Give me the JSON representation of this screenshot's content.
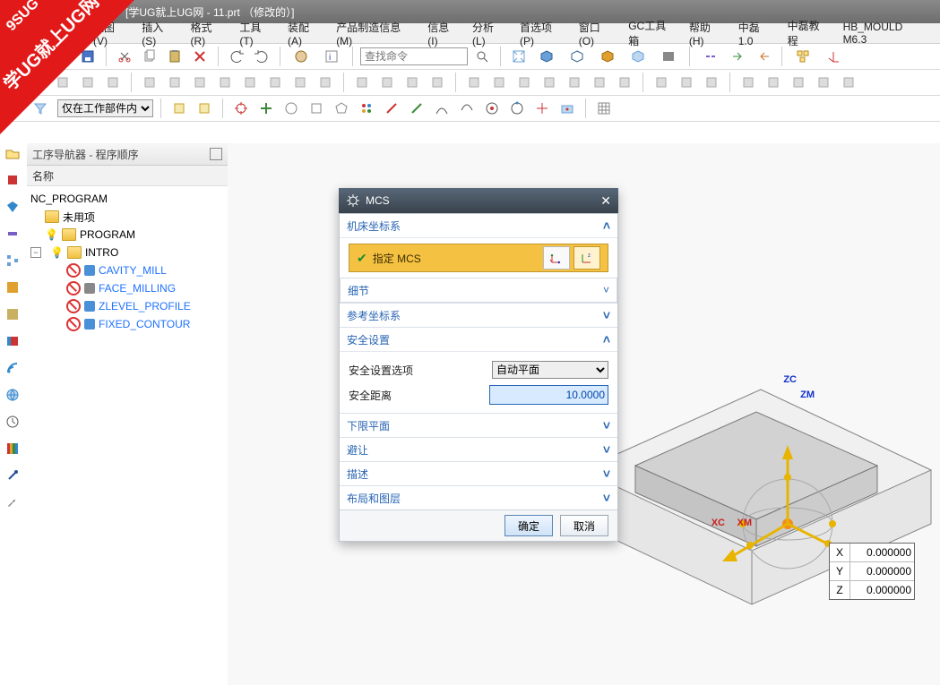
{
  "watermark": {
    "big": "学UG就上UG网",
    "small": "9SUG"
  },
  "title": "[学UG就上UG网 - 11.prt （修改的）]",
  "menus": [
    "视图(V)",
    "插入(S)",
    "格式(R)",
    "工具(T)",
    "装配(A)",
    "产品制造信息(M)",
    "信息(I)",
    "分析(L)",
    "首选项(P)",
    "窗口(O)",
    "GC工具箱",
    "帮助(H)",
    "中磊1.0",
    "中磊教程",
    "HB_MOULD M6.3"
  ],
  "search_placeholder": "查找命令",
  "scope_options": [
    "仅在工作部件内"
  ],
  "scope_value": "仅在工作部件内",
  "nav": {
    "panel_title": "工序导航器 - 程序顺序",
    "column_header": "名称",
    "root": "NC_PROGRAM",
    "unused": "未用项",
    "program": "PROGRAM",
    "intro": "INTRO",
    "ops": [
      "CAVITY_MILL",
      "FACE_MILLING",
      "ZLEVEL_PROFILE",
      "FIXED_CONTOUR"
    ]
  },
  "dialog": {
    "title": "MCS",
    "grp_machine": "机床坐标系",
    "specify_mcs": "指定 MCS",
    "detail": "细节",
    "grp_ref": "参考坐标系",
    "grp_safe": "安全设置",
    "safe_option_label": "安全设置选项",
    "safe_option_value": "自动平面",
    "safe_dist_label": "安全距离",
    "safe_dist_value": "10.0000",
    "grp_lower": "下限平面",
    "grp_avoid": "避让",
    "grp_desc": "描述",
    "grp_layout": "布局和图层",
    "ok": "确定",
    "cancel": "取消"
  },
  "xyz": {
    "x": "0.000000",
    "y": "0.000000",
    "z": "0.000000"
  },
  "axes": {
    "zc": "ZC",
    "zm": "ZM",
    "xc": "XC",
    "xm": "XM"
  }
}
